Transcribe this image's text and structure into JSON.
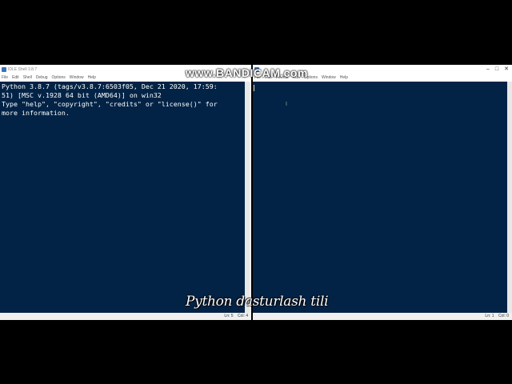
{
  "shell_window": {
    "title": "IDLE Shell 3.8.7",
    "menu": [
      "File",
      "Edit",
      "Shell",
      "Debug",
      "Options",
      "Window",
      "Help"
    ],
    "console_lines": [
      "Python 3.8.7 (tags/v3.8.7:6503f05, Dec 21 2020, 17:59:",
      "51) [MSC v.1928 64 bit (AMD64)] on win32",
      "Type \"help\", \"copyright\", \"credits\" or \"license()\" for",
      "more information."
    ],
    "status": {
      "line": "Ln: 5",
      "col": "Col: 4"
    }
  },
  "editor_window": {
    "menu": [
      "File",
      "Edit",
      "Format",
      "Run",
      "Options",
      "Window",
      "Help"
    ],
    "status": {
      "line": "Ln: 1",
      "col": "Col: 0"
    }
  },
  "window_controls": {
    "minimize": "–",
    "maximize": "□",
    "close": "✕"
  },
  "watermark": "www.BANDICAM.com",
  "caption": "Python dasturlash tili",
  "colors": {
    "console_bg": "#022346",
    "console_text": "#ffffff",
    "desktop": "#000000"
  }
}
